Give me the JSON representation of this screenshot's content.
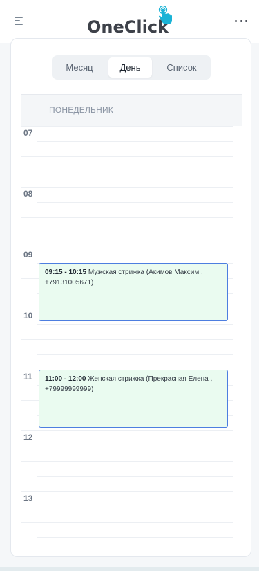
{
  "header": {
    "logo_text": "OneClick",
    "menu_icon": "menu-icon",
    "more_icon": "more-icon"
  },
  "view_switch": {
    "month": "Месяц",
    "day": "День",
    "list": "Список",
    "active": "day"
  },
  "day_header": "ПОНЕДЕЛЬНИК",
  "hours": [
    "07",
    "08",
    "09",
    "10",
    "11",
    "12",
    "13"
  ],
  "events": [
    {
      "time": "09:15 - 10:15",
      "title": "Мужская стрижка (Акимов Максим ,",
      "phone": "+79131005671)"
    },
    {
      "time": "11:00 - 12:00",
      "title": "Женская стрижка (Прекрасная Елена ,",
      "phone": "+79999999999)"
    }
  ],
  "colors": {
    "accent": "#4d7ee0",
    "event_bg": "#eafbf0",
    "logo_hand": "#1ab3d6"
  }
}
